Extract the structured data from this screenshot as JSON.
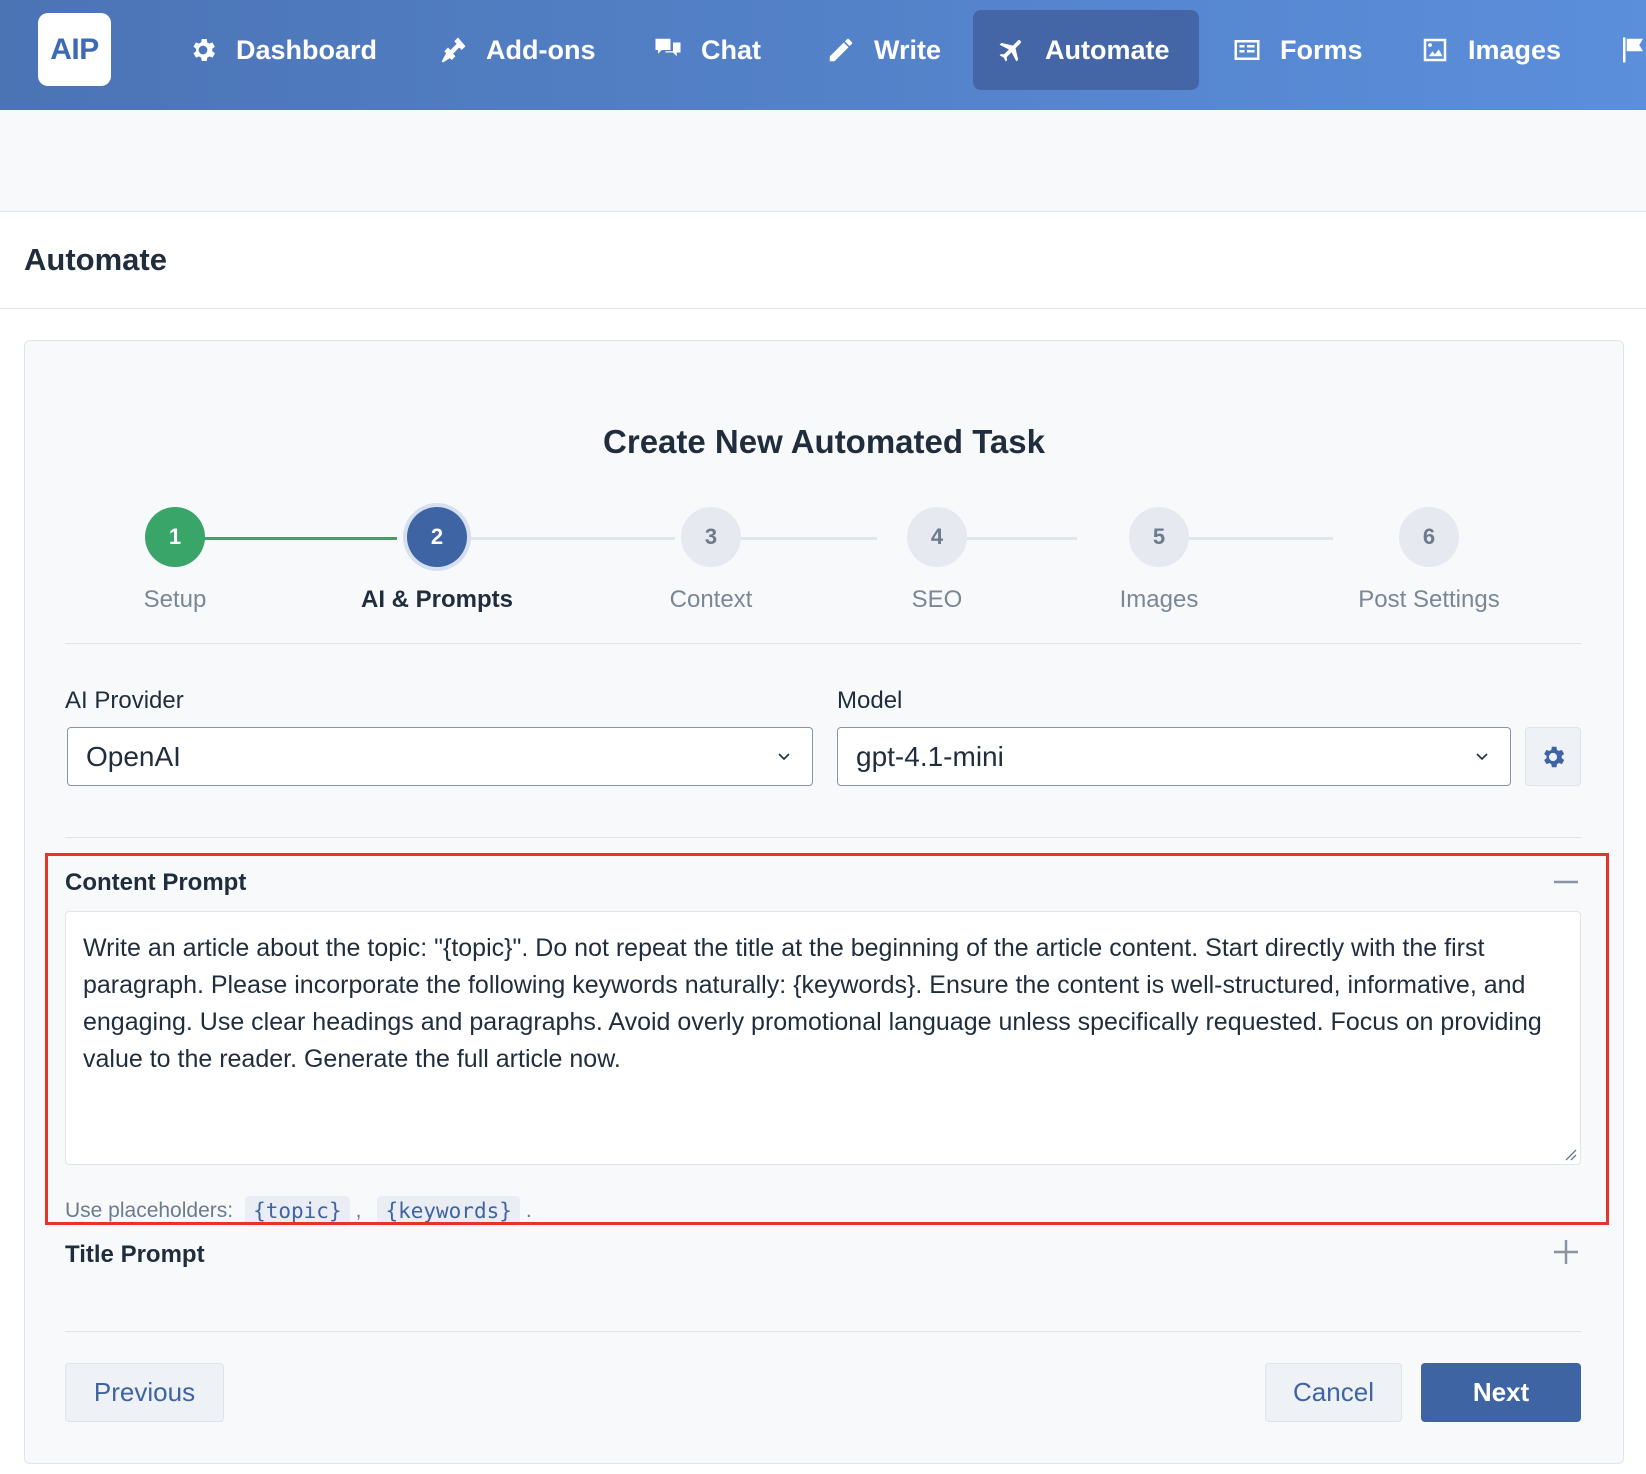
{
  "nav": {
    "logo": "AIP",
    "items": [
      {
        "label": "Dashboard",
        "icon": "gear-icon"
      },
      {
        "label": "Add-ons",
        "icon": "plug-icon"
      },
      {
        "label": "Chat",
        "icon": "chat-bubbles-icon"
      },
      {
        "label": "Write",
        "icon": "pencil-icon"
      },
      {
        "label": "Automate",
        "icon": "plane-icon",
        "active": true
      },
      {
        "label": "Forms",
        "icon": "form-icon"
      },
      {
        "label": "Images",
        "icon": "image-icon"
      }
    ]
  },
  "page": {
    "title": "Automate"
  },
  "card": {
    "title": "Create New Automated Task",
    "steps": [
      {
        "number": "1",
        "label": "Setup",
        "state": "done"
      },
      {
        "number": "2",
        "label": "AI & Prompts",
        "state": "active"
      },
      {
        "number": "3",
        "label": "Context",
        "state": "pending"
      },
      {
        "number": "4",
        "label": "SEO",
        "state": "pending"
      },
      {
        "number": "5",
        "label": "Images",
        "state": "pending"
      },
      {
        "number": "6",
        "label": "Post Settings",
        "state": "pending"
      }
    ],
    "provider": {
      "label": "AI Provider",
      "value": "OpenAI"
    },
    "model": {
      "label": "Model",
      "value": "gpt-4.1-mini"
    },
    "content_prompt": {
      "label": "Content Prompt",
      "value": "Write an article about the topic: \"{topic}\". Do not repeat the title at the beginning of the article content. Start directly with the first paragraph. Please incorporate the following keywords naturally: {keywords}. Ensure the content is well-structured, informative, and engaging. Use clear headings and paragraphs. Avoid overly promotional language unless specifically requested. Focus on providing value to the reader. Generate the full article now.",
      "hint_prefix": "Use placeholders:",
      "placeholders": [
        "{topic}",
        "{keywords}"
      ],
      "separator": ",",
      "hint_suffix": "."
    },
    "title_prompt": {
      "label": "Title Prompt"
    },
    "buttons": {
      "previous": "Previous",
      "cancel": "Cancel",
      "next": "Next"
    }
  },
  "colors": {
    "accent": "#3e64a3",
    "success": "#3aa569",
    "highlight": "#e8322b"
  }
}
